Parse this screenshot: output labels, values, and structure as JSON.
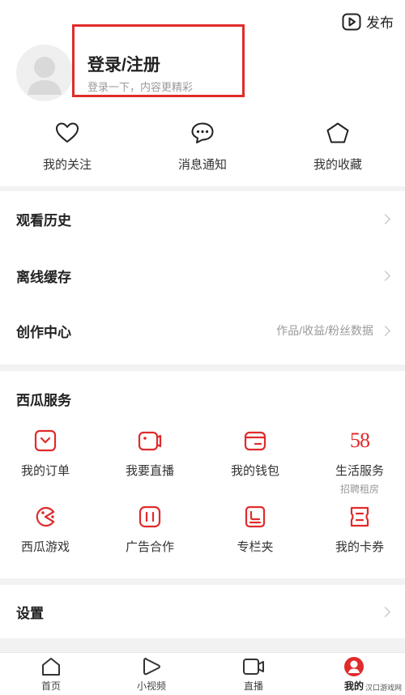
{
  "header": {
    "publish_label": "发布"
  },
  "profile": {
    "login_title": "登录/注册",
    "login_subtitle": "登录一下，内容更精彩"
  },
  "quick_actions": [
    {
      "label": "我的关注",
      "icon": "heart-icon"
    },
    {
      "label": "消息通知",
      "icon": "message-icon"
    },
    {
      "label": "我的收藏",
      "icon": "star-icon"
    }
  ],
  "menu": [
    {
      "label": "观看历史",
      "hint": ""
    },
    {
      "label": "离线缓存",
      "hint": ""
    },
    {
      "label": "创作中心",
      "hint": "作品/收益/粉丝数据"
    }
  ],
  "services": {
    "title": "西瓜服务",
    "items": [
      {
        "label": "我的订单",
        "icon": "order-icon"
      },
      {
        "label": "我要直播",
        "icon": "live-camera-icon"
      },
      {
        "label": "我的钱包",
        "icon": "wallet-icon"
      },
      {
        "label": "生活服务",
        "icon": "58-logo-icon",
        "logo_text": "58",
        "sub": "招聘租房"
      },
      {
        "label": "西瓜游戏",
        "icon": "game-icon"
      },
      {
        "label": "广告合作",
        "icon": "ad-icon"
      },
      {
        "label": "专栏夹",
        "icon": "column-icon"
      },
      {
        "label": "我的卡券",
        "icon": "coupon-icon"
      }
    ]
  },
  "settings": {
    "label": "设置"
  },
  "tabbar": [
    {
      "label": "首页",
      "icon": "home-icon"
    },
    {
      "label": "小视频",
      "icon": "play-icon"
    },
    {
      "label": "直播",
      "icon": "live-icon"
    },
    {
      "label": "我的",
      "icon": "profile-icon",
      "active": true
    }
  ],
  "watermark": "汉口游戏网",
  "colors": {
    "accent": "#e02b2b",
    "text": "#222222",
    "muted": "#999999",
    "background": "#f2f2f2"
  }
}
